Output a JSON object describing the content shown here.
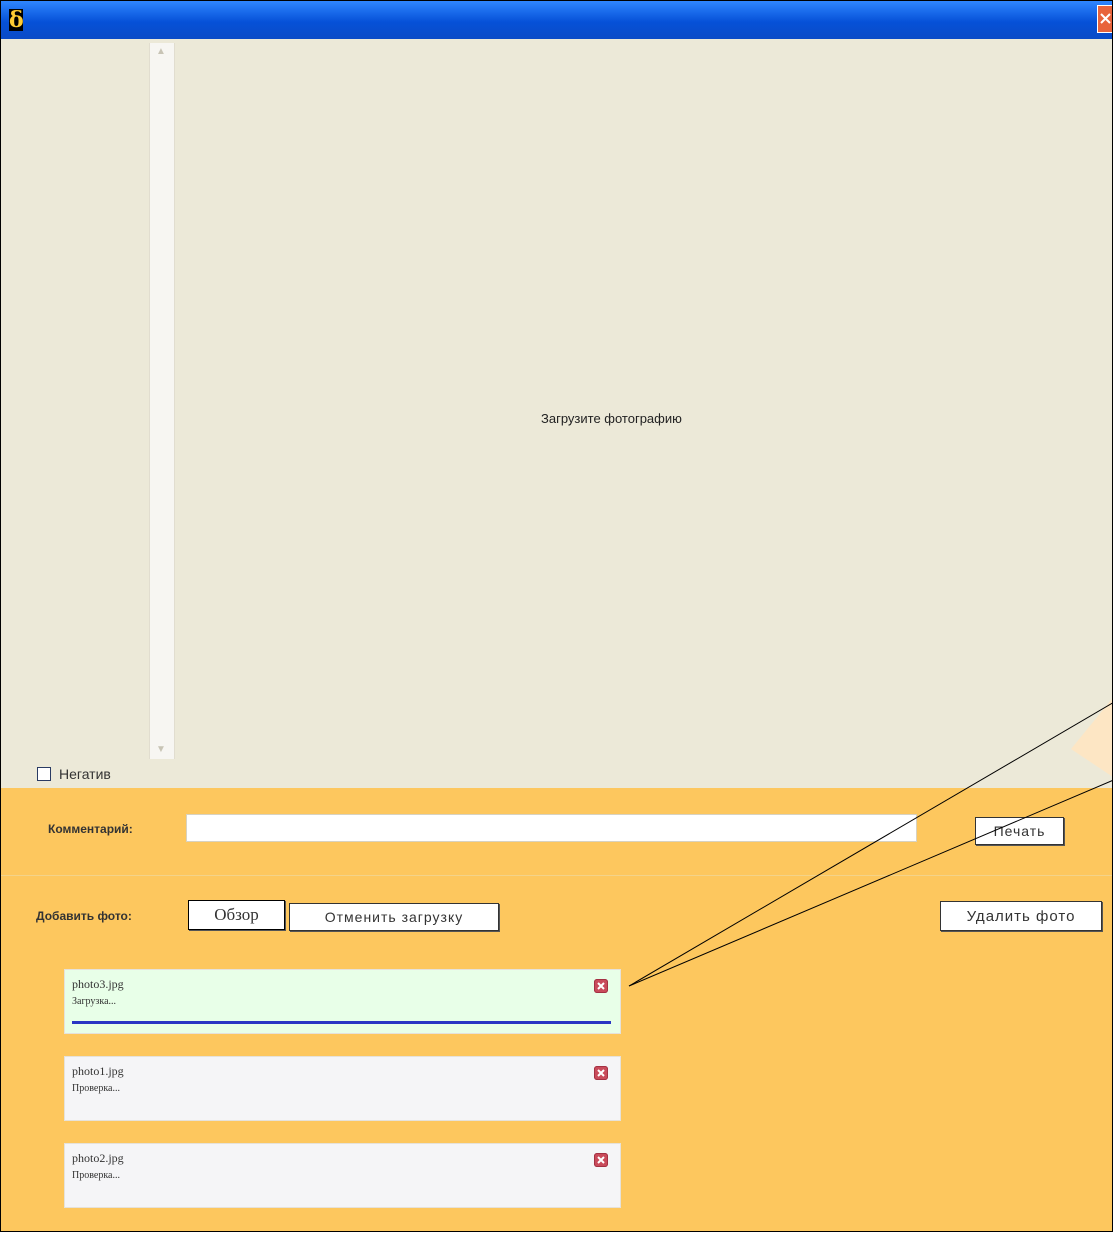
{
  "window": {
    "app_icon": "δ"
  },
  "viewer": {
    "placeholder": "Загрузите фотографию"
  },
  "negativ": {
    "label": "Негатив",
    "checked": false
  },
  "comment": {
    "label": "Комментарий:",
    "value": "",
    "print_button": "Печать"
  },
  "add_photo": {
    "label": "Добавить фото:",
    "browse_button": "Обзор",
    "cancel_button": "Отменить загрузку",
    "delete_button": "Удалить фото"
  },
  "uploads": [
    {
      "file": "photo3.jpg",
      "status": "Загрузка...",
      "active": true
    },
    {
      "file": "photo1.jpg",
      "status": "Проверка...",
      "active": false
    },
    {
      "file": "photo2.jpg",
      "status": "Проверка...",
      "active": false
    }
  ],
  "colors": {
    "titlebar": "#0651d8",
    "panel": "#fdc75e",
    "viewer": "#ece9d8",
    "progress": "#2a35c4",
    "remove": "#c94b5b"
  }
}
